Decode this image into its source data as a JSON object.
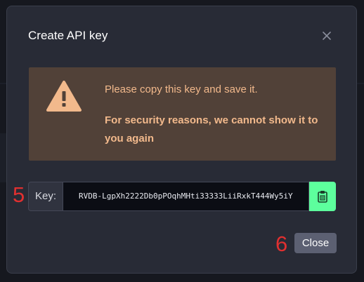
{
  "dialog": {
    "title": "Create API key",
    "close_icon": "close-icon"
  },
  "warning": {
    "icon": "warning-triangle-icon",
    "line1": "Please copy this key and save it.",
    "line2": "For security reasons, we cannot show it to you again"
  },
  "key": {
    "label": "Key:",
    "value": "RVDB-LgpXh2222Db0pPOqhMHti33333LiiRxkT444Wy5iY",
    "copy_icon": "clipboard-icon"
  },
  "annotations": {
    "step_key": "5",
    "step_close": "6"
  },
  "footer": {
    "close_label": "Close"
  },
  "colors": {
    "accent_copy": "#5dff9d",
    "warning_bg": "#514138",
    "warning_text": "#f2b98c",
    "annotation": "#e03030"
  }
}
